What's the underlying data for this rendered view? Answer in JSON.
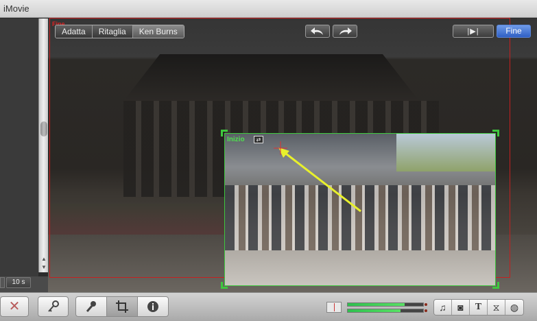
{
  "window": {
    "title": "iMovie"
  },
  "viewer": {
    "mode_buttons": [
      "Adatta",
      "Ritaglia",
      "Ken Burns"
    ],
    "end_tag": "Fine",
    "start_label": "Inizio",
    "swap_icon": "swap-icon",
    "undo_icon": "undo-icon",
    "redo_icon": "redo-icon",
    "play_icon": "play-frame-icon",
    "done_label": "Fine"
  },
  "sidebar": {
    "duration": "10 s"
  },
  "toolbar": {
    "reject_icon": "x-icon",
    "keyword_icon": "key-icon",
    "voiceover_icon": "microphone-icon",
    "crop_icon": "crop-icon",
    "info_icon": "info-icon",
    "audio_meter_icon": "audio-level-icon",
    "audio_level_left": 0.75,
    "audio_level_right": 0.7,
    "tray_icons": [
      "music-note-icon",
      "camera-icon",
      "title-text-icon",
      "transition-icon",
      "globe-icon"
    ]
  },
  "colors": {
    "accent": "#2f5fc4",
    "start_frame": "#3ec93e",
    "end_frame": "#c61f1f",
    "motion_arrow": "#e8f02c"
  }
}
